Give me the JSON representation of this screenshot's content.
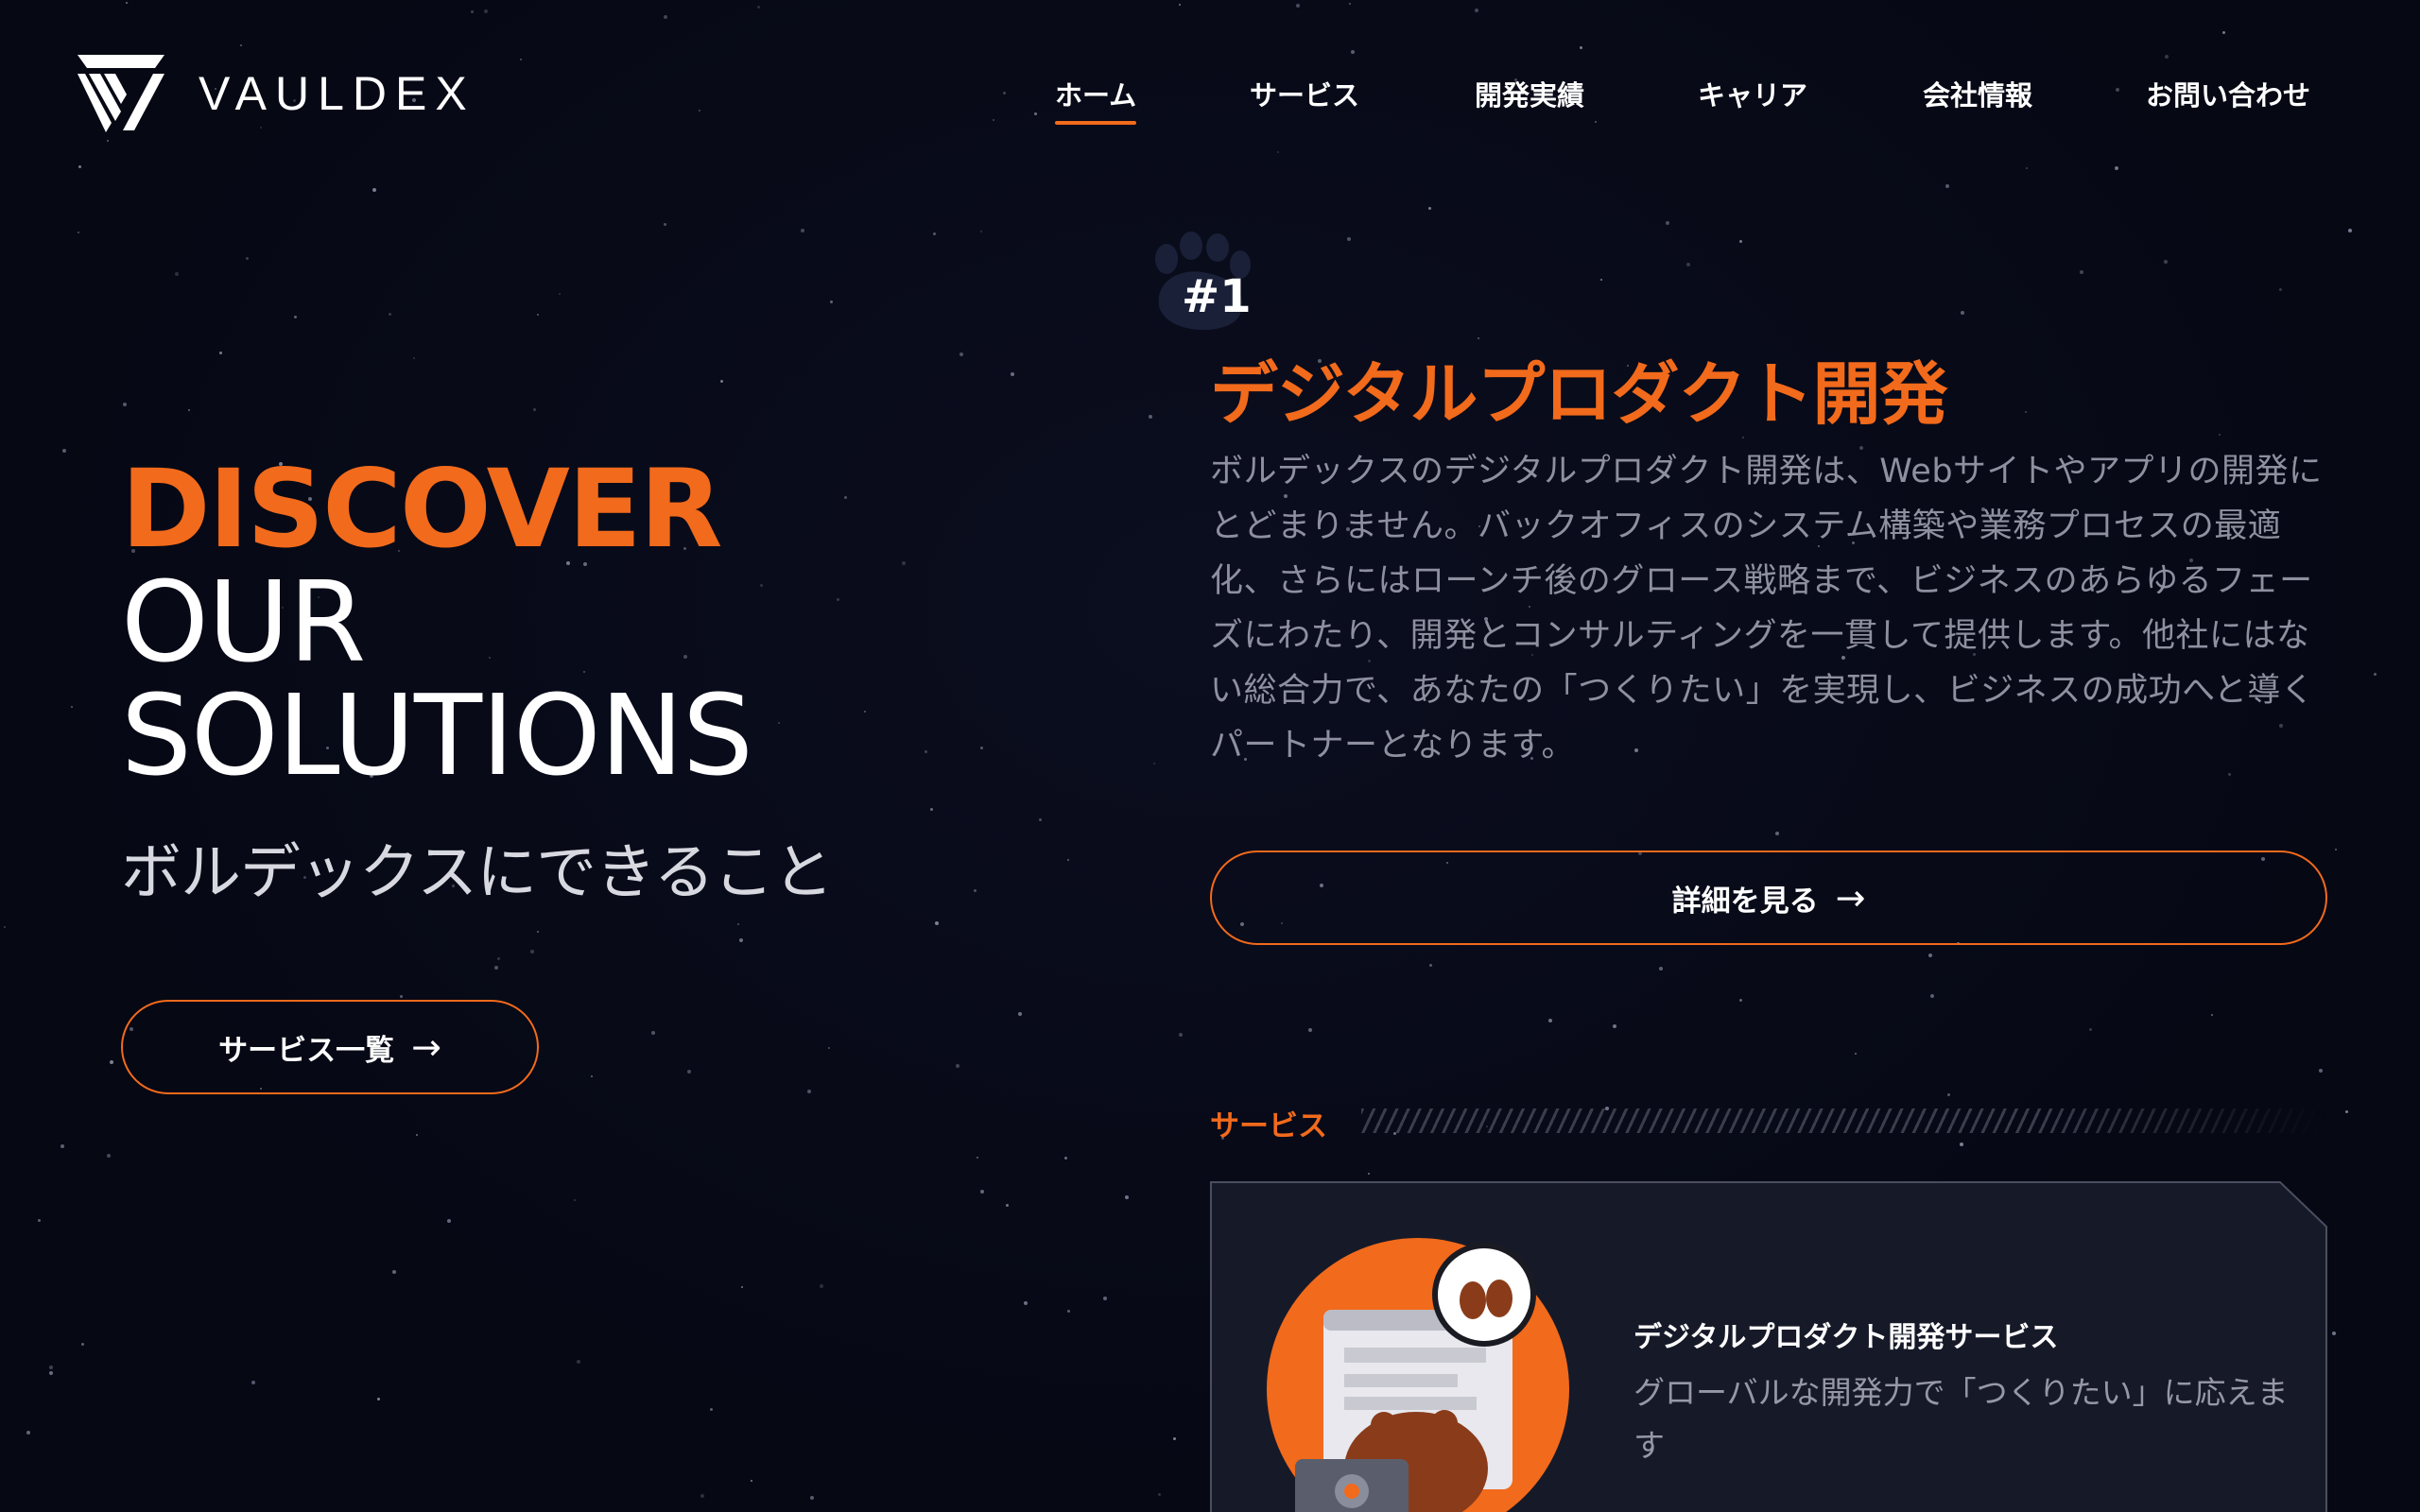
{
  "brand": {
    "name": "VAULDEX",
    "accent_color": "#f26a1b",
    "background_color": "#060814"
  },
  "nav": {
    "items": [
      {
        "label": "ホーム",
        "active": true
      },
      {
        "label": "サービス",
        "active": false
      },
      {
        "label": "開発実績",
        "active": false
      },
      {
        "label": "キャリア",
        "active": false
      },
      {
        "label": "会社情報",
        "active": false
      },
      {
        "label": "お問い合わせ",
        "active": false
      }
    ]
  },
  "hero": {
    "line1": "DISCOVER",
    "line2": "OUR",
    "line3": "SOLUTIONS",
    "subtitle": "ボルデックスにできること",
    "button_label": "サービス一覧",
    "button_icon": "arrow-right-icon"
  },
  "feature": {
    "number": "#1",
    "number_icon": "paw-icon",
    "title": "デジタルプロダクト開発",
    "description": "ボルデックスのデジタルプロダクト開発は、Webサイトやアプリの開発にとどまりません。バックオフィスのシステム構築や業務プロセスの最適化、さらにはローンチ後のグロース戦略まで、ビジネスのあらゆるフェーズにわたり、開発とコンサルティングを一貫して提供します。他社にはない総合力で、あなたの「つくりたい」を実現し、ビジネスの成功へと導くパートナーとなります。",
    "button_label": "詳細を見る",
    "button_icon": "arrow-right-icon"
  },
  "services_section": {
    "label": "サービス",
    "card": {
      "title": "デジタルプロダクト開発サービス",
      "description": "グローバルな開発力で「つくりたい」に応えます",
      "illustration": "bear-developer-illustration"
    }
  }
}
